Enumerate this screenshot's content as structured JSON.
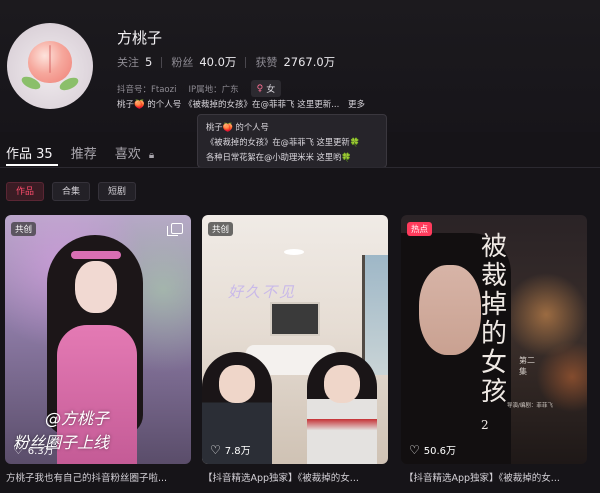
{
  "profile": {
    "name": "方桃子",
    "following_label": "关注",
    "following": "5",
    "followers_label": "粉丝",
    "followers": "40.0万",
    "likes_label": "获赞",
    "likes": "2767.0万",
    "douyin_id": "抖音号：Ftaozi",
    "ip_location": "IP属地：广东",
    "gender": "女",
    "bio": "桃子🍑 的个人号 《被裁掉的女孩》在@菲菲飞 这里更新...",
    "more": "更多"
  },
  "tooltip": {
    "lines": [
      "桃子🍑 的个人号",
      "《被裁掉的女孩》在@菲菲飞 这里更新🍀",
      "各种日常花絮在@小助理米米 这里哟🍀"
    ]
  },
  "tabs": [
    {
      "label": "作品",
      "count": "35"
    },
    {
      "label": "推荐"
    },
    {
      "label": "喜欢"
    }
  ],
  "subtabs": [
    "作品",
    "合集",
    "短剧"
  ],
  "videos": [
    {
      "badge": "共创",
      "likes": "6.3万",
      "overlay1": "@方桃子",
      "overlay2": "粉丝圈子上线",
      "caption": "方桃子我也有自己的抖音粉丝圈子啦..."
    },
    {
      "badge": "共创",
      "likes": "7.8万",
      "script": "好久不见",
      "caption": "【抖音精选App独家】《被裁掉的女..."
    },
    {
      "badge": "热点",
      "likes": "50.6万",
      "title_chars": [
        "被",
        "裁",
        "掉",
        "的",
        "女",
        "孩"
      ],
      "title_sup": "2",
      "episode": "第二集",
      "credit": "导演/编剧：菲菲飞",
      "caption": "【抖音精选App独家】《被裁掉的女..."
    }
  ],
  "colors": {
    "accent": "#ff4d6d",
    "background": "#161418"
  }
}
